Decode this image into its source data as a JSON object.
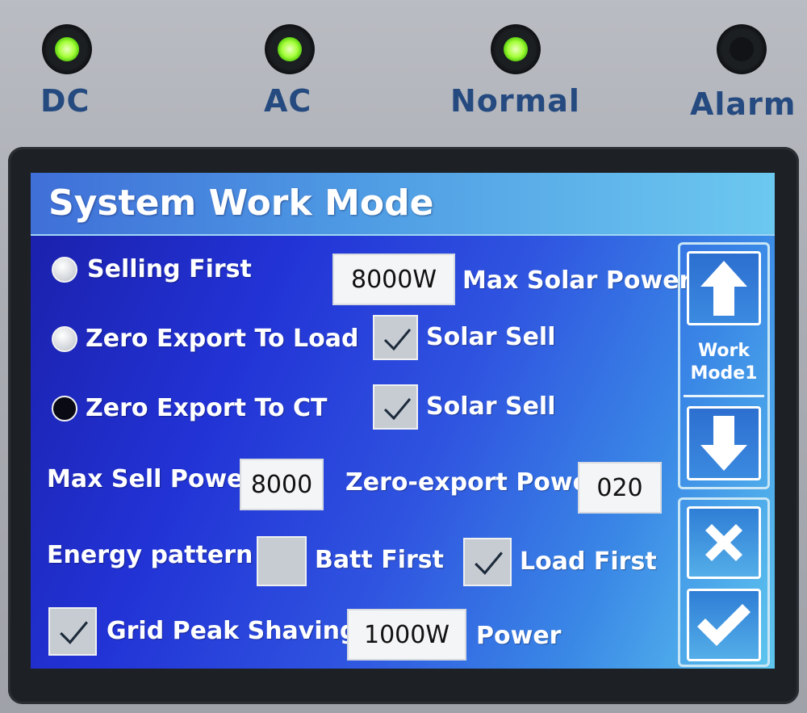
{
  "indicators": [
    {
      "label": "DC",
      "state": "on"
    },
    {
      "label": "AC",
      "state": "on"
    },
    {
      "label": "Normal",
      "state": "on"
    },
    {
      "label": "Alarm",
      "state": "off"
    }
  ],
  "colors": {
    "led_on": "#a6ff3a",
    "label": "#254a80",
    "screen_blue": "#2233d6",
    "title_bar": "#4f9ce4"
  },
  "screen": {
    "title": "System Work Mode",
    "modes": {
      "selling_first": {
        "label": "Selling First",
        "selected": false
      },
      "zero_export_load": {
        "label": "Zero Export To Load",
        "selected": false
      },
      "zero_export_ct": {
        "label": "Zero Export To CT",
        "selected": true
      }
    },
    "max_solar_power": {
      "value": "8000W",
      "label": "Max Solar Power"
    },
    "solar_sell_load": {
      "label": "Solar Sell",
      "checked": true
    },
    "solar_sell_ct": {
      "label": "Solar Sell",
      "checked": true
    },
    "max_sell_power": {
      "label": "Max Sell Power",
      "value": "8000"
    },
    "zero_export_power": {
      "label": "Zero-export Power",
      "value": "020"
    },
    "energy_pattern": {
      "label": "Energy pattern",
      "batt_first": {
        "label": "Batt First",
        "checked": false
      },
      "load_first": {
        "label": "Load First",
        "checked": true
      }
    },
    "grid_peak_shaving": {
      "label": "Grid Peak Shaving",
      "checked": true,
      "value": "1000W",
      "unit_label": "Power"
    },
    "side": {
      "mode_label_line1": "Work",
      "mode_label_line2": "Mode1",
      "up_icon": "arrow-up-icon",
      "down_icon": "arrow-down-icon",
      "cancel_icon": "x-icon",
      "confirm_icon": "check-icon"
    }
  }
}
